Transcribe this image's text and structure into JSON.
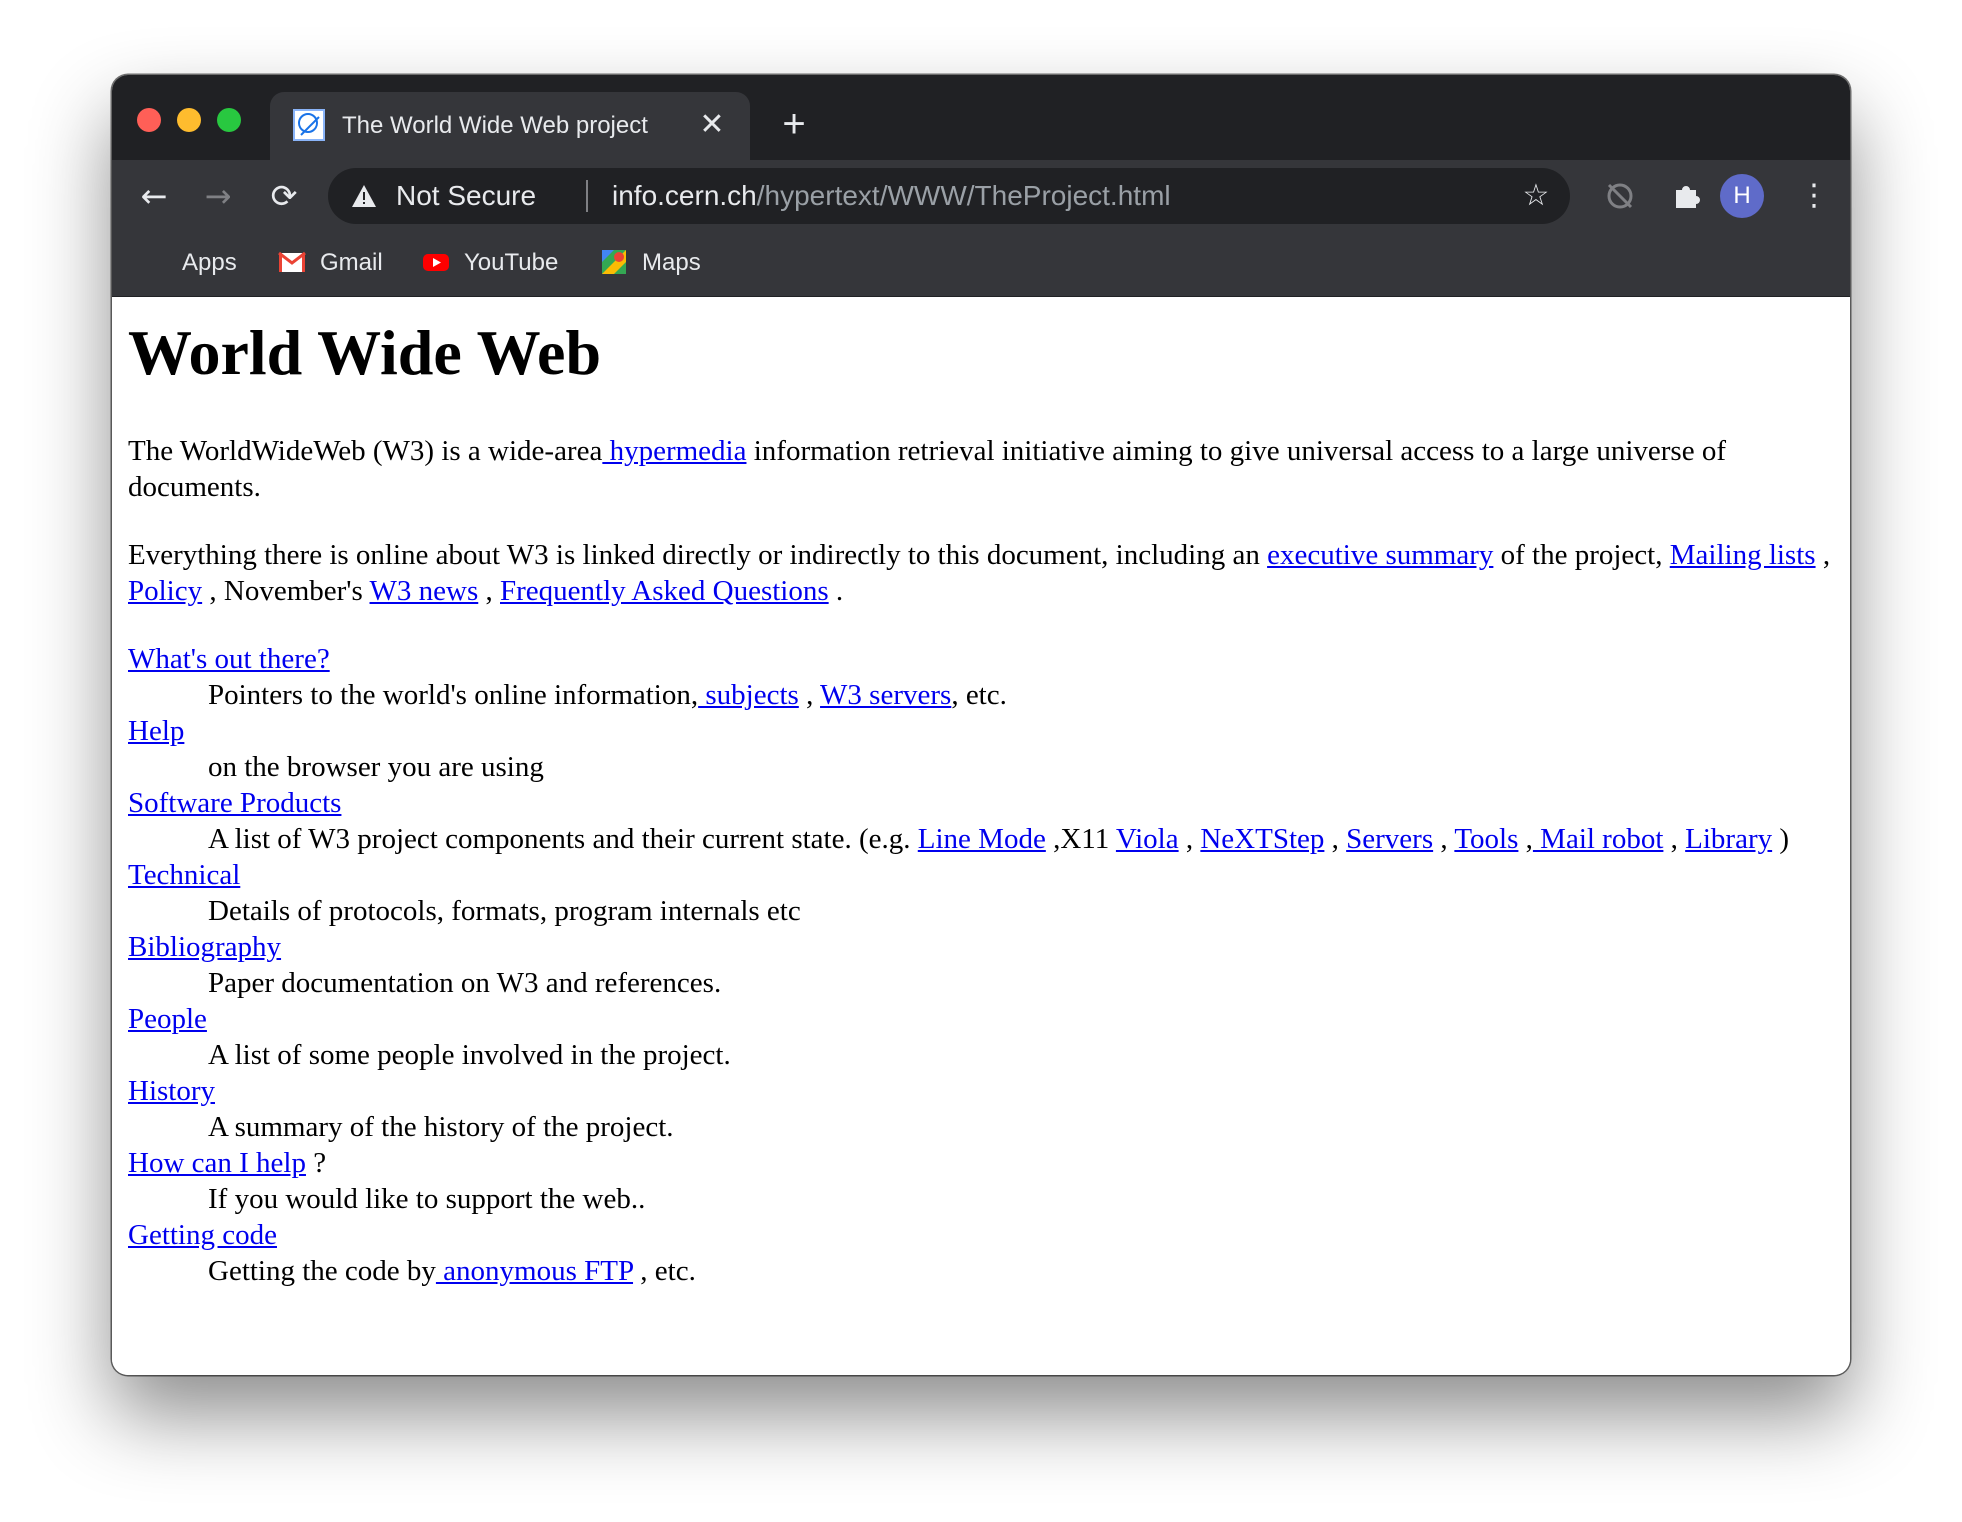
{
  "browser": {
    "tab": {
      "title": "The World Wide Web project",
      "close": "✕"
    },
    "new_tab": "+",
    "toolbar": {
      "back": "←",
      "forward": "→",
      "reload": "⟳",
      "security_label": "Not Secure",
      "url_host": "info.cern.ch",
      "url_path": "/hypertext/WWW/TheProject.html",
      "star": "☆",
      "avatar_letter": "H",
      "menu": "⋮"
    },
    "bookmarks": [
      {
        "label": "Apps",
        "icon": "apps-grid-icon"
      },
      {
        "label": "Gmail",
        "icon": "gmail-icon"
      },
      {
        "label": "YouTube",
        "icon": "youtube-icon"
      },
      {
        "label": "Maps",
        "icon": "maps-icon"
      }
    ],
    "colors": {
      "frame": "#202124",
      "toolbar": "#35363a",
      "link": "#0000ee",
      "avatar": "#5f6bc9"
    }
  },
  "page": {
    "heading": "World Wide Web",
    "p1": {
      "t1": "The WorldWideWeb (W3) is a wide-area",
      "link_hypermedia": " hypermedia",
      "t2": " information retrieval initiative aiming to give universal access to a large universe of documents."
    },
    "p2": {
      "t1": "Everything there is online about W3 is linked directly or indirectly to this document, including an ",
      "link_exec": "executive summary",
      "t2": " of the project, ",
      "link_mailing": "Mailing lists",
      "t3": " , ",
      "link_policy": "Policy",
      "t4": " , November's ",
      "link_news": "W3 news",
      "t5": " , ",
      "link_faq": "Frequently Asked Questions",
      "t6": " ."
    },
    "entries": {
      "whats_out": {
        "link": "What's out there?",
        "desc1": "Pointers to the world's online information,",
        "link_subjects": " subjects",
        "sep": " , ",
        "link_servers": "W3 servers",
        "desc2": ", etc."
      },
      "help": {
        "link": "Help",
        "desc": "on the browser you are using"
      },
      "software": {
        "link": "Software Products",
        "desc1": "A list of W3 project components and their current state. (e.g. ",
        "link_linemode": "Line Mode",
        "t_x11": " ,X11 ",
        "link_viola": "Viola",
        "s1": " , ",
        "link_next": "NeXTStep",
        "s2": " , ",
        "link_servers": "Servers",
        "s3": " , ",
        "link_tools": "Tools",
        "s4": " ,",
        "link_mail": " Mail robot",
        "s5": " , ",
        "link_library": "Library",
        "end": " )"
      },
      "technical": {
        "link": "Technical",
        "desc": "Details of protocols, formats, program internals etc"
      },
      "bibliography": {
        "link": "Bibliography",
        "desc": "Paper documentation on W3 and references."
      },
      "people": {
        "link": "People",
        "desc": "A list of some people involved in the project."
      },
      "history": {
        "link": "History",
        "desc": "A summary of the history of the project."
      },
      "howhelp": {
        "link": "How can I help",
        "after": " ?",
        "desc": "If you would like to support the web.."
      },
      "getting": {
        "link": "Getting code",
        "desc1": "Getting the code by",
        "link_ftp": " anonymous FTP",
        "desc2": " , etc."
      }
    }
  }
}
